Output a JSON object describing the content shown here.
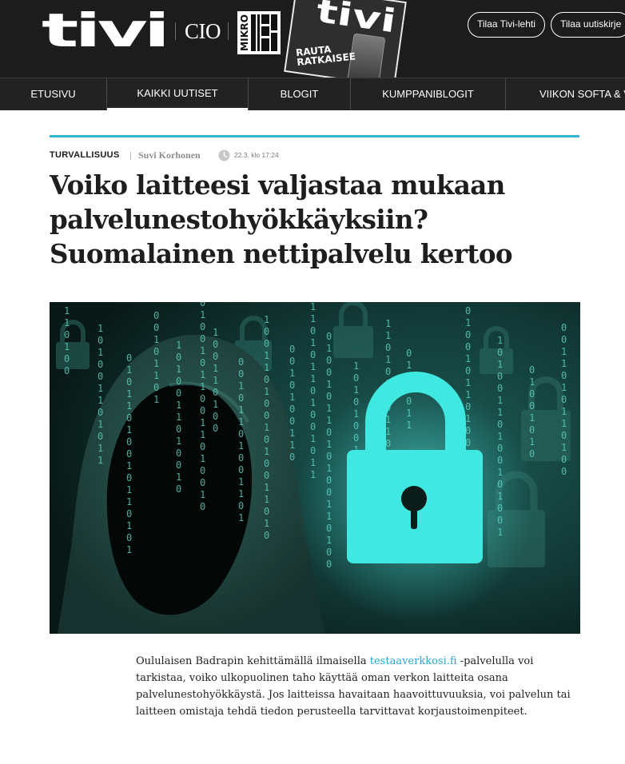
{
  "header": {
    "logo_text": "tivi",
    "cio": "CIO",
    "mikro_logo": "MIKRO",
    "magazine": {
      "title": "tivi",
      "cover_text": "RAUTA RATKAISEE"
    },
    "buttons": [
      "Tilaa Tivi-lehti",
      "Tilaa uutiskirje"
    ]
  },
  "nav": {
    "items": [
      "ETUSIVU",
      "KAIKKI UUTISET",
      "BLOGIT",
      "KUMPPANIBLOGIT",
      "VIIKON SOFTA & V"
    ],
    "active": "KAIKKI UUTISET"
  },
  "article": {
    "category": "TURVALLISUUS",
    "author": "Suvi Korhonen",
    "date": "22.3. klo 17:24",
    "title_lines": [
      "Voiko laitteesi valjastaa mukaan",
      "palvelunestohyökkäyksiin?",
      "Suomalainen nettipalvelu kertoo"
    ],
    "hero_image": {
      "icons": [
        "hooded-figure",
        "padlock",
        "binary-code"
      ],
      "digits": "0110100101001101011010010110101001101001011001101001011010"
    },
    "lead_before_link": "Oululaisen Badrapin kehittämällä ilmaisella ",
    "lead_link": "testaaverkkosi.fi",
    "lead_after_link": " -palvelulla voi tarkistaa, voiko ulkopuolinen taho käyttää oman verkon laitteita osana palvelunestohyökkäystä. Jos laitteissa havaitaan haavoittuvuuksia, voi palvelun tai laitteen omistaja tehdä tiedon perusteella tarvittavat korjaustoimenpiteet."
  },
  "colors": {
    "accent": "#35b4d8",
    "header_bg": "#1c1c1c",
    "nav_bg": "#222222",
    "link": "#2aa7cf",
    "lock_cyan": "#3fe8e0"
  }
}
